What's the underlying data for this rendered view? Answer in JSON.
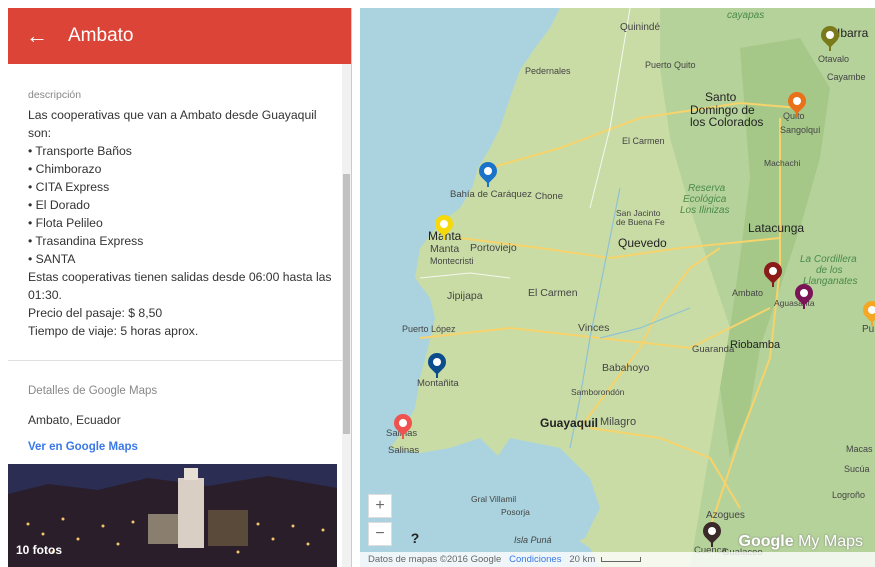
{
  "panel": {
    "title": "Ambato",
    "desc_label": "descripción",
    "desc_lines": [
      "Las cooperativas que van a Ambato desde Guayaquil",
      "son:",
      "• Transporte Baños",
      "• Chimborazo",
      "• CITA Express",
      "• El Dorado",
      "• Flota Pelileo",
      "• Trasandina Express",
      "• SANTA",
      "Estas cooperativas tienen salidas desde 06:00 hasta las",
      "01:30.",
      " Precio del pasaje: $ 8,50",
      "Tiempo de viaje: 5 horas aprox."
    ],
    "details_label": "Detalles de Google Maps",
    "details_value": "Ambato, Ecuador",
    "details_link": "Ver en Google Maps",
    "photo_caption": "10 fotos"
  },
  "map": {
    "labels": {
      "quininde": "Quinindé",
      "pedernales": "Pedernales",
      "puerto_quito": "Puerto Quito",
      "santo_domingo_1": "Santo",
      "santo_domingo_2": "Domingo de",
      "santo_domingo_3": "los Colorados",
      "el_carmen_n": "El Carmen",
      "bahia": "Bahía de Caráquez",
      "chone": "Chone",
      "manta": "Manta",
      "portoviejo": "Portoviejo",
      "montecristi": "Montecristi",
      "quevedo": "Quevedo",
      "san_jacinto": "San Jacinto",
      "de_buena_fe": "de Buena Fe",
      "reserva1": "Reserva",
      "reserva2": "Ecológica",
      "reserva3": "Los Ilinizas",
      "latacunga": "Latacunga",
      "jipijapa": "Jipijapa",
      "el_carmen_s": "El Carmen",
      "puerto_lopez": "Puerto López",
      "vinces": "Vinces",
      "montanita": "Montañita",
      "babahoyo": "Babahoyo",
      "samborondon": "Samborondón",
      "guayaquil": "Guayaquil",
      "milagro": "Milagro",
      "salinas": "Salinas",
      "guaranda": "Guaranda",
      "riobamba": "Riobamba",
      "ambato": "Ambato",
      "aguasanta": "Aguasanta",
      "gral_villamil": "Gral Villamil",
      "posorja": "Posorja",
      "isla_puna": "Isla Puná",
      "azogues": "Azogues",
      "cuenca": "Cuenca",
      "gualaceo": "Gualaceo",
      "quito": "Quito",
      "sangolqui": "Sangolquí",
      "machachi": "Machachi",
      "otavalo": "Otavalo",
      "ibarra": "Ibarra",
      "cayambe": "Cayambe",
      "cayapas": "cayapas",
      "macas": "Macas",
      "sucua": "Sucúa",
      "logrono": "Logroño",
      "cordillera1": "La Cordillera",
      "cordillera2": "de los",
      "cordillera3": "Llanganates",
      "puyo": "Pu"
    },
    "zoom_in": "+",
    "zoom_out": "−",
    "help": "?",
    "footer_data": "Datos de mapas ©2016 Google",
    "footer_terms": "Condiciones",
    "footer_scale": "20 km",
    "brand_google": "Google",
    "brand_my": "My Maps",
    "colors": {
      "header": "#db4437",
      "pin_blue": "#1a73c8",
      "pin_yellow": "#f5d90a",
      "pin_darkblue": "#0b4c8c",
      "pin_red": "#ef5350",
      "pin_darkred": "#8b1a1a",
      "pin_purple": "#7b1357",
      "pin_orange": "#e8711a",
      "pin_olive": "#7b7a1a",
      "pin_dark": "#3a2a2a",
      "pin_amber": "#f5a623"
    }
  }
}
